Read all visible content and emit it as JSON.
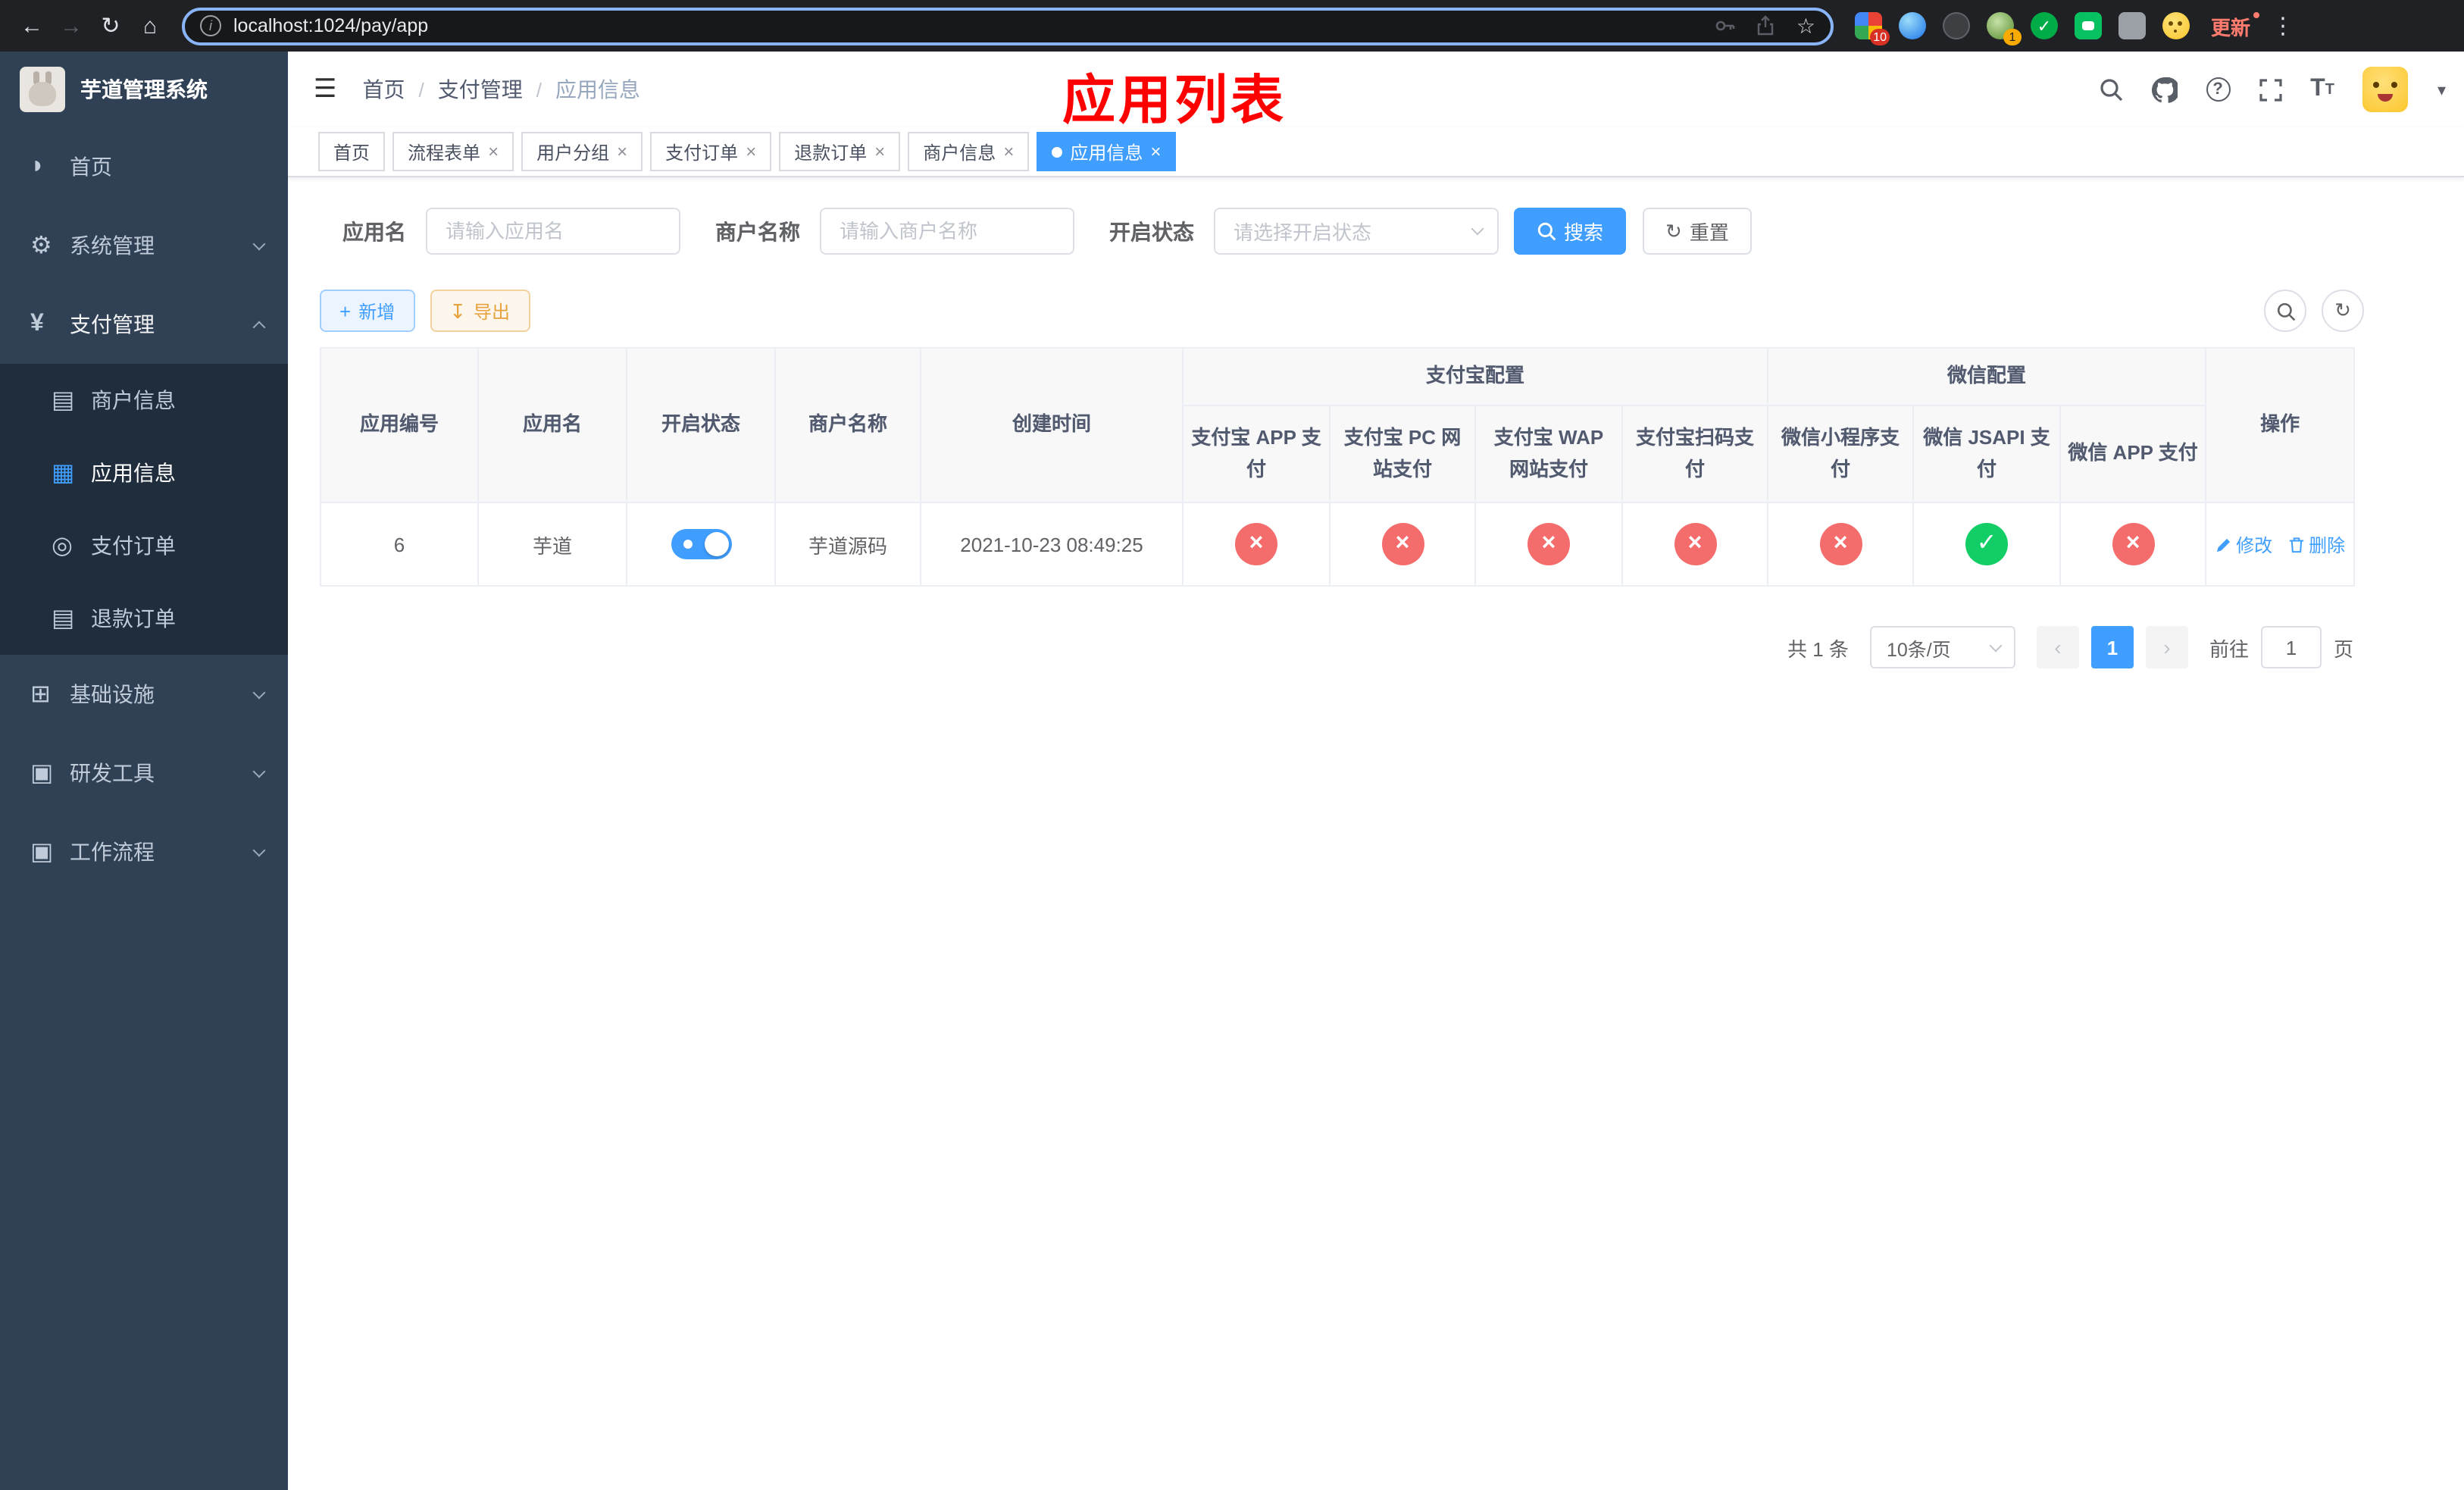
{
  "browser": {
    "url": "localhost:1024/pay/app",
    "update_label": "更新",
    "extension_badge": "10",
    "profile_badge": "1"
  },
  "sidebar": {
    "title": "芋道管理系统",
    "items": [
      {
        "label": "首页",
        "icon": "dashboard-icon"
      },
      {
        "label": "系统管理",
        "icon": "gear-icon"
      },
      {
        "label": "支付管理",
        "icon": "yen-icon"
      },
      {
        "label": "基础设施",
        "icon": "infrastructure-icon"
      },
      {
        "label": "研发工具",
        "icon": "dev-tools-icon"
      },
      {
        "label": "工作流程",
        "icon": "workflow-icon"
      }
    ],
    "payment_children": [
      {
        "label": "商户信息",
        "icon": "card-icon"
      },
      {
        "label": "应用信息",
        "icon": "grid-icon"
      },
      {
        "label": "支付订单",
        "icon": "order-icon"
      },
      {
        "label": "退款订单",
        "icon": "refund-icon"
      }
    ]
  },
  "header": {
    "breadcrumb": {
      "home": "首页",
      "section": "支付管理",
      "page": "应用信息"
    },
    "annotation": "应用列表"
  },
  "tabs": [
    {
      "label": "首页"
    },
    {
      "label": "流程表单"
    },
    {
      "label": "用户分组"
    },
    {
      "label": "支付订单"
    },
    {
      "label": "退款订单"
    },
    {
      "label": "商户信息"
    },
    {
      "label": "应用信息"
    }
  ],
  "filters": {
    "app_name_label": "应用名",
    "app_name_placeholder": "请输入应用名",
    "merchant_label": "商户名称",
    "merchant_placeholder": "请输入商户名称",
    "status_label": "开启状态",
    "status_placeholder": "请选择开启状态",
    "search_label": "搜索",
    "reset_label": "重置"
  },
  "toolbar": {
    "add_label": "新增",
    "export_label": "导出"
  },
  "table": {
    "group_headers": {
      "alipay": "支付宝配置",
      "wechat": "微信配置"
    },
    "columns": [
      "应用编号",
      "应用名",
      "开启状态",
      "商户名称",
      "创建时间",
      "支付宝 APP 支付",
      "支付宝 PC 网站支付",
      "支付宝 WAP 网站支付",
      "支付宝扫码支付",
      "微信小程序支付",
      "微信 JSAPI 支付",
      "微信 APP 支付",
      "操作"
    ],
    "row": {
      "id": "6",
      "name": "芋道",
      "enabled": true,
      "merchant": "芋道源码",
      "created": "2021-10-23 08:49:25",
      "statuses": [
        "fail",
        "fail",
        "fail",
        "fail",
        "fail",
        "success",
        "fail"
      ],
      "edit_label": "修改",
      "delete_label": "删除"
    }
  },
  "pagination": {
    "total": "共 1 条",
    "page_size": "10条/页",
    "current_page": "1",
    "goto_label": "前往",
    "goto_value": "1",
    "page_suffix": "页"
  },
  "colors": {
    "primary": "#409eff",
    "danger": "#f56c6c",
    "success": "#13ce66",
    "warning": "#e6a23c",
    "sidebar_bg": "#304156",
    "submenu_bg": "#1f2d3d",
    "annotation": "#ff0000"
  }
}
